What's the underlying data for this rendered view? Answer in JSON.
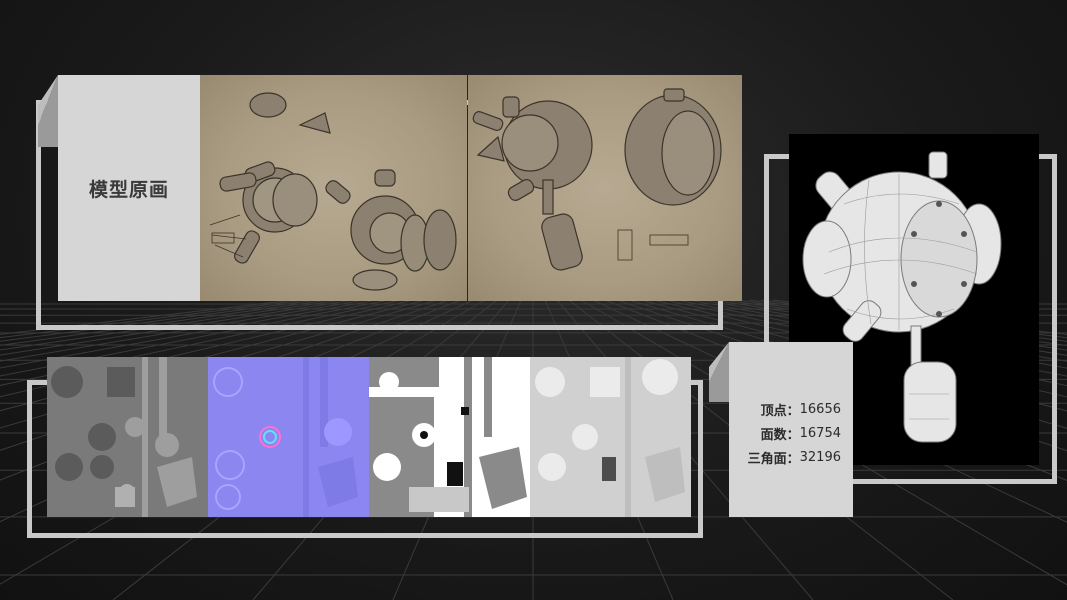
{
  "concept": {
    "title": "模型原画"
  },
  "stats": {
    "rows": [
      {
        "label": "顶点：",
        "value": "16656"
      },
      {
        "label": "面数：",
        "value": "16754"
      },
      {
        "label": "三角面：",
        "value": "32196"
      }
    ]
  },
  "colors": {
    "frame": "#c9c9c9",
    "card": "#d6d6d6",
    "paper": "#b0a389",
    "normal_map": "#8a86f0",
    "render_bg": "#000000"
  },
  "textures": [
    "diffuse-map",
    "normal-map",
    "roughness-map",
    "ao-map"
  ]
}
